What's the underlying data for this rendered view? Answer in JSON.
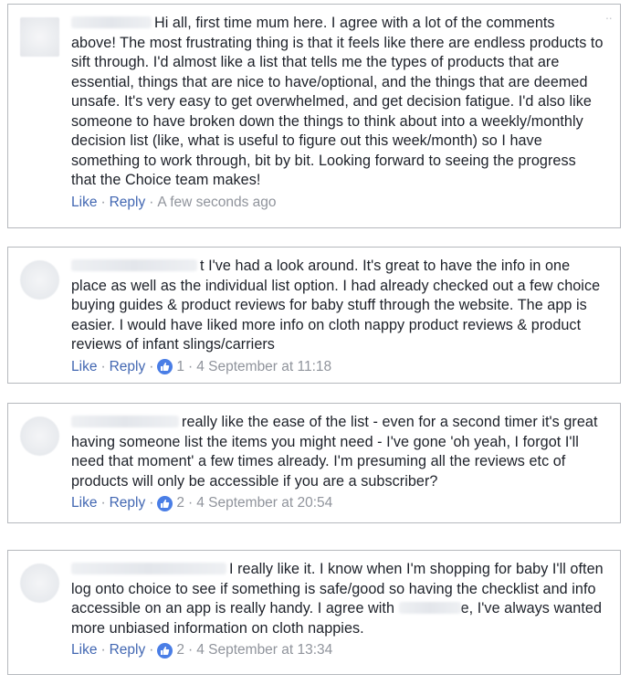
{
  "comments": [
    {
      "text": "Hi all, first time mum here. I agree with a lot of the comments above! The most frustrating thing is that it feels like there are endless products to sift through. I'd almost like a list that tells me the types of products that are essential, things that are nice to have/optional, and the things that are deemed unsafe. It's very easy to get overwhelmed, and get decision fatigue. I'd also like someone to have broken down the things to think about into a weekly/monthly decision list (like, what is useful to figure out this week/month) so I have something to work through, bit by bit. Looking forward to seeing the progress that the Choice team makes!",
      "like_label": "Like",
      "reply_label": "Reply",
      "reaction_count": "",
      "timestamp": "A few seconds ago"
    },
    {
      "text": "t I've had a look around. It's great to have the info in one place as well as the individual list option. I had already checked out a few choice buying guides & product reviews for baby stuff through the website. The app is easier. I would have liked more info on cloth nappy product reviews & product reviews of infant slings/carriers",
      "like_label": "Like",
      "reply_label": "Reply",
      "reaction_count": "1",
      "timestamp": "4 September at 11:18"
    },
    {
      "text": "really like the ease of the list - even for a second timer it's great having someone list the items you might need - I've gone 'oh yeah, I forgot I'll need that moment' a few times already. I'm presuming all the reviews etc of products will only be accessible if you are a subscriber?",
      "like_label": "Like",
      "reply_label": "Reply",
      "reaction_count": "2",
      "timestamp": "4 September at 20:54"
    },
    {
      "text": "I really like it. I know when I'm shopping for baby I'll often log onto choice to see if something is safe/good so having the checklist and info accessible on an app is really handy. I agree with",
      "text_tail": "e, I've always wanted more unbiased information on cloth nappies.",
      "like_label": "Like",
      "reply_label": "Reply",
      "reaction_count": "2",
      "timestamp": "4 September at 13:34"
    }
  ],
  "separator": "·",
  "more_menu": "··",
  "colors": {
    "link": "#4267b2",
    "meta": "#90949c",
    "text": "#1d2129",
    "border": "#b5b8bd",
    "like_bubble": "#4a7ee6"
  },
  "icons": [
    "like-reaction-icon",
    "more-options-icon"
  ]
}
